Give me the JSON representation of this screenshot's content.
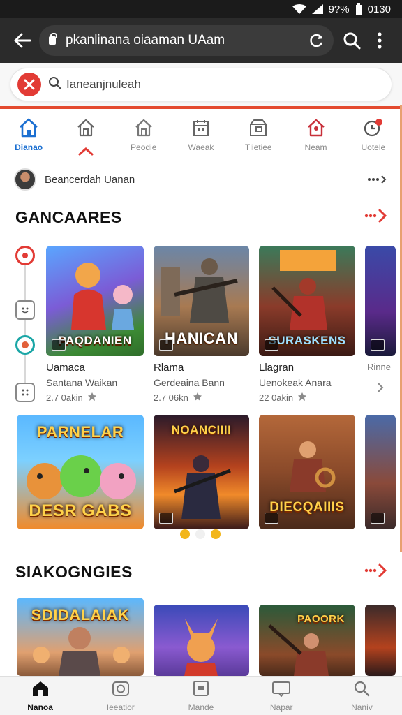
{
  "status_bar": {
    "battery": "9?%",
    "time": "0130"
  },
  "browser": {
    "url": "pkanlinana oiaaman UAam"
  },
  "search": {
    "text": "Ianeanjnuleah"
  },
  "tabs": [
    {
      "label": "Dianao",
      "icon": "home-icon",
      "active": true
    },
    {
      "label": "",
      "icon": "home-outline-icon",
      "active": false
    },
    {
      "label": "Peodie",
      "icon": "house-icon",
      "active": false
    },
    {
      "label": "Waeak",
      "icon": "calendar-icon",
      "active": false
    },
    {
      "label": "Tlietiee",
      "icon": "store-icon",
      "active": false
    },
    {
      "label": "Neam",
      "icon": "home-red-icon",
      "active": false
    },
    {
      "label": "Uotele",
      "icon": "clock-icon",
      "active": false
    }
  ],
  "profile": {
    "name": "Beancerdah Uanan"
  },
  "section1": {
    "title": "GANCAARES"
  },
  "section2": {
    "title": "SIAKOGNGIES"
  },
  "cards_row1": [
    {
      "art_title": "PAQDANIEN",
      "title": "Uamaca",
      "subtitle": "Santana Waikan",
      "stat": "2.7 0akin"
    },
    {
      "art_title": "HANICAN",
      "title": "Rlama",
      "subtitle": "Gerdeaina Bann",
      "stat": "2.7 06kn"
    },
    {
      "art_title": "SURASKENS",
      "title": "Llagran",
      "subtitle": "Uenokeak Anara",
      "stat": "22 0akin"
    },
    {
      "art_title": "",
      "title": "Rinne",
      "subtitle": "",
      "stat": ""
    }
  ],
  "cards_row2": [
    {
      "art_title_top": "PARNELAR",
      "art_title": "DESR GABS"
    },
    {
      "art_title_top": "NOANCIIII",
      "art_title": ""
    },
    {
      "art_title_top": "",
      "art_title": "DIECQAIIIS"
    },
    {
      "art_title_top": "",
      "art_title": ""
    }
  ],
  "cards_row3": [
    {
      "art_title_top": "SDIDALAIAK"
    },
    {
      "art_title_top": ""
    },
    {
      "art_title_top": "PAOORK"
    },
    {
      "art_title_top": ""
    }
  ],
  "bottom_nav": [
    {
      "label": "Nanoa",
      "icon": "home-icon",
      "active": true
    },
    {
      "label": "Ieeatior",
      "icon": "camera-icon",
      "active": false
    },
    {
      "label": "Mande",
      "icon": "card-icon",
      "active": false
    },
    {
      "label": "Napar",
      "icon": "book-icon",
      "active": false
    },
    {
      "label": "Naniv",
      "icon": "search-icon",
      "active": false
    }
  ],
  "colors": {
    "accent": "#e23b35",
    "active_tab": "#1b6fd1",
    "dot": "#f2b61c"
  }
}
